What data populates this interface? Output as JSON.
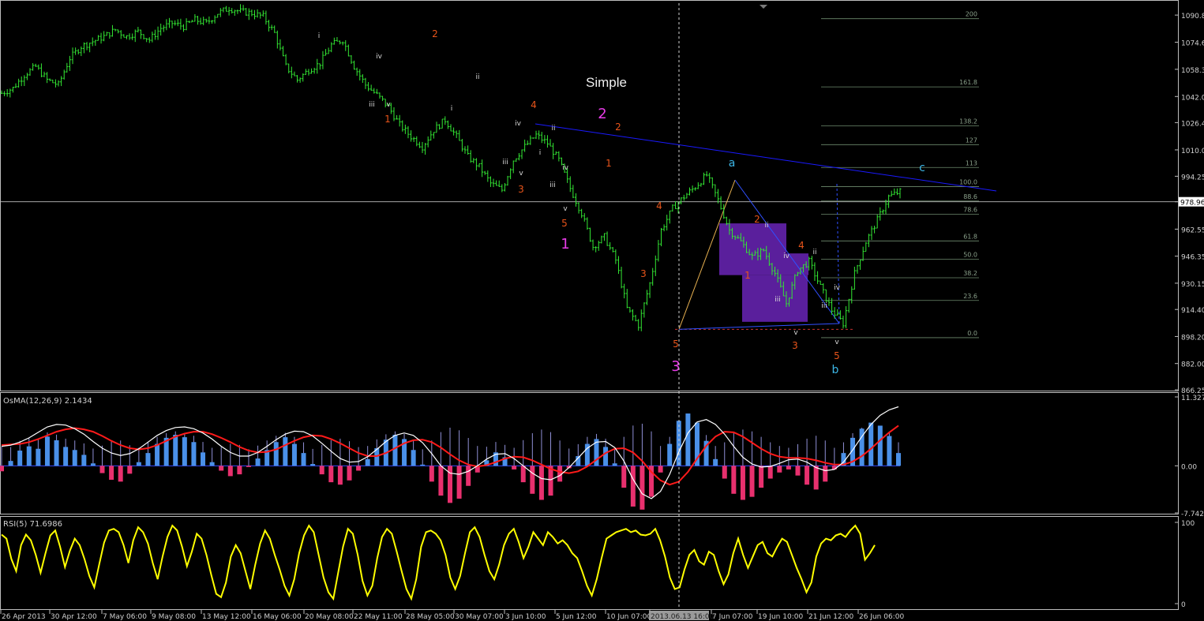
{
  "colors": {
    "background": "#000000",
    "candle": "#33e633",
    "grid_line": "#c0c0c0",
    "trendline": "#1a1aff",
    "fib": "#6e8b6e",
    "box": "#5a1f9c",
    "osma_pos": "#4a90e8",
    "osma_neg": "#e8306e",
    "osma_hist": "#8f8fd6",
    "macd_main": "#ffffff",
    "macd_signal": "#ff1a1a",
    "rsi": "#ffff00",
    "wave_orange": "#e8541a",
    "wave_magenta": "#e83ce8",
    "wave_cyan": "#3cb6e6",
    "wave_white": "#d8d8d8",
    "axis_text": "#d0d0d0"
  },
  "chart_data": [
    {
      "type": "candlestick",
      "panel": "main",
      "symbol_note": "Simple",
      "ylim": [
        866.25,
        1098.0
      ],
      "y_ticks": [
        "1090.85",
        "1074.60",
        "1058.35",
        "1042.05",
        "1026.40",
        "1010.05",
        "994.25",
        "978.96",
        "962.55",
        "946.35",
        "930.15",
        "914.40",
        "898.20",
        "882.00",
        "866.25"
      ],
      "current_price": "978.96",
      "close_path": [
        1044,
        1047,
        1055,
        1060,
        1052,
        1049,
        1065,
        1072,
        1075,
        1078,
        1082,
        1078,
        1081,
        1076,
        1083,
        1086,
        1084,
        1088,
        1086,
        1092,
        1095,
        1093,
        1092,
        1090,
        1080,
        1060,
        1052,
        1058,
        1062,
        1073,
        1076,
        1060,
        1049,
        1043,
        1036,
        1025,
        1018,
        1012,
        1022,
        1028,
        1018,
        1006,
        1000,
        990,
        986,
        1004,
        1012,
        1019,
        1014,
        1004,
        987,
        972,
        952,
        958,
        944,
        915,
        905,
        930,
        962,
        975,
        982,
        988,
        995,
        980,
        962,
        955,
        946,
        950,
        936,
        918,
        938,
        943,
        928,
        914,
        906,
        936,
        955,
        968,
        982,
        985
      ],
      "fib_levels": [
        {
          "label": "200",
          "value": 1088.7
        },
        {
          "label": "161.8",
          "value": 1047.8
        },
        {
          "label": "138.2",
          "value": 1024.4
        },
        {
          "label": "127",
          "value": 1013.2
        },
        {
          "label": "113",
          "value": 999.5
        },
        {
          "label": "100.0",
          "value": 988.0
        },
        {
          "label": "88.6",
          "value": 979.4
        },
        {
          "label": "78.6",
          "value": 971.5
        },
        {
          "label": "61.8",
          "value": 955.5
        },
        {
          "label": "50.0",
          "value": 944.6
        },
        {
          "label": "38.2",
          "value": 933.4
        },
        {
          "label": "23.6",
          "value": 919.8
        },
        {
          "label": "0.0",
          "value": 897.5
        }
      ],
      "wave_labels": [
        {
          "text": "i",
          "color": "white"
        },
        {
          "text": "iv",
          "color": "white"
        },
        {
          "text": "iii",
          "color": "white"
        },
        {
          "text": "v",
          "color": "white"
        },
        {
          "text": "1",
          "color": "orange"
        },
        {
          "text": "2",
          "color": "orange"
        },
        {
          "text": "ii",
          "color": "white"
        },
        {
          "text": "i",
          "color": "white"
        },
        {
          "text": "4",
          "color": "orange"
        },
        {
          "text": "iv",
          "color": "white"
        },
        {
          "text": "ii",
          "color": "white"
        },
        {
          "text": "i",
          "color": "white"
        },
        {
          "text": "iii",
          "color": "white"
        },
        {
          "text": "v",
          "color": "white"
        },
        {
          "text": "3",
          "color": "orange"
        },
        {
          "text": "2",
          "color": "magenta"
        },
        {
          "text": "2",
          "color": "orange"
        },
        {
          "text": "1",
          "color": "orange"
        },
        {
          "text": "iv",
          "color": "white"
        },
        {
          "text": "iii",
          "color": "white"
        },
        {
          "text": "v",
          "color": "white"
        },
        {
          "text": "5",
          "color": "orange"
        },
        {
          "text": "1",
          "color": "magenta"
        },
        {
          "text": "4",
          "color": "orange"
        },
        {
          "text": "3",
          "color": "orange"
        },
        {
          "text": "5",
          "color": "orange"
        },
        {
          "text": "3",
          "color": "magenta"
        },
        {
          "text": "a",
          "color": "cyan"
        },
        {
          "text": "2",
          "color": "orange"
        },
        {
          "text": "ii",
          "color": "white"
        },
        {
          "text": "1",
          "color": "orange"
        },
        {
          "text": "4",
          "color": "orange"
        },
        {
          "text": "iv",
          "color": "white"
        },
        {
          "text": "iii",
          "color": "white"
        },
        {
          "text": "v",
          "color": "white"
        },
        {
          "text": "3",
          "color": "orange"
        },
        {
          "text": "ii",
          "color": "white"
        },
        {
          "text": "iv",
          "color": "white"
        },
        {
          "text": "iii",
          "color": "white"
        },
        {
          "text": "v",
          "color": "white"
        },
        {
          "text": "5",
          "color": "orange"
        },
        {
          "text": "b",
          "color": "cyan"
        },
        {
          "text": "c",
          "color": "cyan"
        }
      ]
    },
    {
      "type": "bar",
      "panel": "osma",
      "title": "OsMA(12,26,9) 2.1434",
      "ylim": [
        -7.7422,
        11.327
      ],
      "y_ticks": [
        "11.327",
        "0.00",
        "-7.7422"
      ],
      "hist_values": [
        -0.9,
        0.8,
        2.5,
        3.2,
        2.8,
        4.8,
        4.2,
        3.1,
        2.6,
        1.8,
        0.4,
        -1.2,
        -2.3,
        -2.6,
        -1.3,
        0.6,
        2.1,
        3.6,
        4.6,
        5.1,
        4.7,
        3.9,
        2.2,
        0.6,
        -0.8,
        -1.7,
        -1.4,
        -0.2,
        1.2,
        2.6,
        3.9,
        4.7,
        3.6,
        2.1,
        0.3,
        -1.4,
        -2.7,
        -3.1,
        -2.4,
        -0.8,
        1.1,
        2.9,
        4.3,
        5.1,
        4.4,
        2.6,
        0.2,
        -2.6,
        -4.9,
        -6.1,
        -5.4,
        -3.3,
        -1.1,
        0.9,
        2.2,
        1.4,
        -0.6,
        -2.7,
        -4.6,
        -5.6,
        -4.9,
        -2.6,
        -0.4,
        1.6,
        3.6,
        4.4,
        3.1,
        0.4,
        -3.6,
        -6.7,
        -7.2,
        -5.1,
        -1.1,
        3.6,
        7.4,
        8.6,
        7.1,
        4.1,
        1.1,
        -2.1,
        -4.6,
        -5.6,
        -5.1,
        -3.6,
        -2.1,
        -1.1,
        -0.6,
        -1.6,
        -3.1,
        -3.9,
        -2.6,
        -0.6,
        2.1,
        4.6,
        6.1,
        7.1,
        6.6,
        4.9,
        2.1
      ],
      "main_values": [
        3.2,
        3.4,
        3.9,
        4.6,
        5.5,
        6.4,
        6.8,
        6.7,
        6.1,
        5.2,
        4.0,
        2.9,
        2.1,
        1.7,
        2.0,
        2.8,
        3.9,
        5.0,
        5.8,
        6.3,
        6.4,
        6.1,
        5.4,
        4.4,
        3.2,
        2.2,
        1.6,
        1.6,
        2.2,
        3.2,
        4.3,
        5.2,
        5.7,
        5.6,
        4.9,
        3.7,
        2.4,
        1.2,
        0.6,
        0.7,
        1.5,
        2.7,
        4.0,
        5.0,
        5.4,
        5.0,
        3.8,
        2.0,
        0.0,
        -1.2,
        -1.4,
        -0.9,
        0.0,
        1.1,
        1.9,
        2.0,
        1.2,
        0.0,
        -1.2,
        -2.1,
        -2.3,
        -1.6,
        -0.3,
        1.3,
        2.9,
        3.9,
        4.0,
        3.0,
        0.8,
        -2.2,
        -4.6,
        -5.4,
        -4.2,
        -1.4,
        2.3,
        5.4,
        7.2,
        7.6,
        6.8,
        5.2,
        3.2,
        1.4,
        0.3,
        -0.2,
        -0.1,
        0.4,
        1.0,
        1.1,
        0.6,
        -0.3,
        -0.8,
        -0.6,
        0.6,
        2.6,
        4.8,
        6.8,
        8.3,
        9.2,
        9.7
      ],
      "signal_values": [
        3.4,
        3.5,
        3.6,
        3.9,
        4.4,
        5.0,
        5.6,
        6.0,
        6.2,
        6.0,
        5.6,
        4.9,
        4.1,
        3.4,
        2.9,
        2.7,
        2.9,
        3.4,
        4.1,
        4.8,
        5.3,
        5.6,
        5.6,
        5.2,
        4.6,
        3.9,
        3.1,
        2.5,
        2.2,
        2.3,
        2.7,
        3.4,
        4.1,
        4.7,
        5.0,
        4.9,
        4.4,
        3.7,
        2.9,
        2.1,
        1.6,
        1.6,
        2.1,
        2.9,
        3.7,
        4.2,
        4.3,
        3.9,
        3.0,
        1.9,
        0.9,
        0.2,
        -0.1,
        0.1,
        0.6,
        1.2,
        1.5,
        1.4,
        0.9,
        0.2,
        -0.5,
        -1.0,
        -1.2,
        -0.9,
        -0.1,
        1.0,
        2.1,
        2.8,
        2.9,
        2.2,
        0.8,
        -1.0,
        -2.4,
        -3.1,
        -2.6,
        -1.0,
        1.2,
        3.3,
        4.8,
        5.6,
        5.5,
        4.8,
        3.8,
        2.8,
        2.0,
        1.5,
        1.3,
        1.3,
        1.2,
        0.9,
        0.5,
        0.2,
        0.2,
        0.7,
        1.6,
        2.8,
        4.2,
        5.5,
        6.6
      ]
    },
    {
      "type": "line",
      "panel": "rsi",
      "title": "RSI(5) 71.6986",
      "ylim": [
        0,
        100
      ],
      "y_ticks": [
        "100",
        "0"
      ],
      "values": [
        85,
        80,
        55,
        40,
        72,
        85,
        78,
        60,
        38,
        62,
        84,
        90,
        70,
        45,
        65,
        80,
        72,
        55,
        34,
        20,
        48,
        75,
        90,
        92,
        88,
        72,
        50,
        78,
        94,
        88,
        74,
        50,
        30,
        58,
        82,
        96,
        90,
        70,
        46,
        64,
        86,
        80,
        60,
        35,
        12,
        8,
        26,
        58,
        72,
        62,
        40,
        18,
        48,
        74,
        90,
        80,
        60,
        42,
        22,
        10,
        30,
        62,
        84,
        96,
        88,
        60,
        32,
        14,
        6,
        38,
        70,
        92,
        86,
        60,
        28,
        10,
        22,
        56,
        82,
        92,
        86,
        64,
        40,
        18,
        6,
        30,
        70,
        88,
        90,
        86,
        78,
        60,
        32,
        18,
        34,
        62,
        88,
        94,
        82,
        60,
        40,
        30,
        48,
        72,
        86,
        92,
        76,
        56,
        70,
        88,
        80,
        72,
        88,
        82,
        74,
        78
      ],
      "values_right": [
        72,
        62,
        56,
        40,
        22,
        10,
        30,
        56,
        80,
        84,
        88,
        90,
        92,
        88,
        90,
        85,
        84,
        86,
        92,
        78,
        58,
        32,
        18,
        20,
        42,
        60,
        66,
        52,
        48,
        64,
        60,
        40,
        24,
        36,
        62,
        80,
        60,
        44,
        58,
        72,
        76,
        62,
        58,
        70,
        80,
        76,
        60,
        44,
        30,
        14,
        26,
        58,
        74,
        80,
        78,
        84,
        86,
        82,
        90,
        96,
        86,
        54,
        62,
        72
      ]
    }
  ],
  "x_ticks": [
    "26 Apr 2013",
    "30 Apr 12:00",
    "7 May 06:00",
    "9 May 08:00",
    "13 May 12:00",
    "16 May 06:00",
    "20 May 08:00",
    "22 May 11:00",
    "28 May 05:00",
    "30 May 07:00",
    "3 Jun 10:00",
    "5 Jun 12:00",
    "10 Jun 07:00",
    "2013.06.13 16:00",
    "7 Jun 07:00",
    "19 Jun 10:00",
    "21 Jun 12:00",
    "26 Jun 06:00"
  ],
  "crosshair_time": "2013.06.13 16:00"
}
